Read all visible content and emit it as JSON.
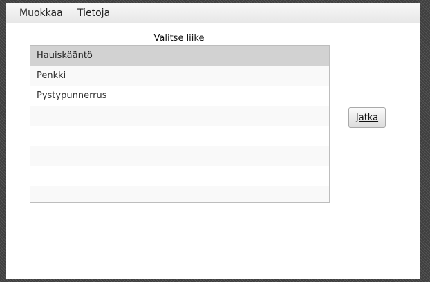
{
  "menubar": {
    "items": [
      {
        "label": "Muokkaa"
      },
      {
        "label": "Tietoja"
      }
    ]
  },
  "exercise_list": {
    "title": "Valitse liike",
    "selected_index": 0,
    "items": [
      {
        "label": "Hauiskääntö"
      },
      {
        "label": "Penkki"
      },
      {
        "label": "Pystypunnerrus"
      }
    ]
  },
  "continue_button": {
    "label": "Jatka"
  }
}
